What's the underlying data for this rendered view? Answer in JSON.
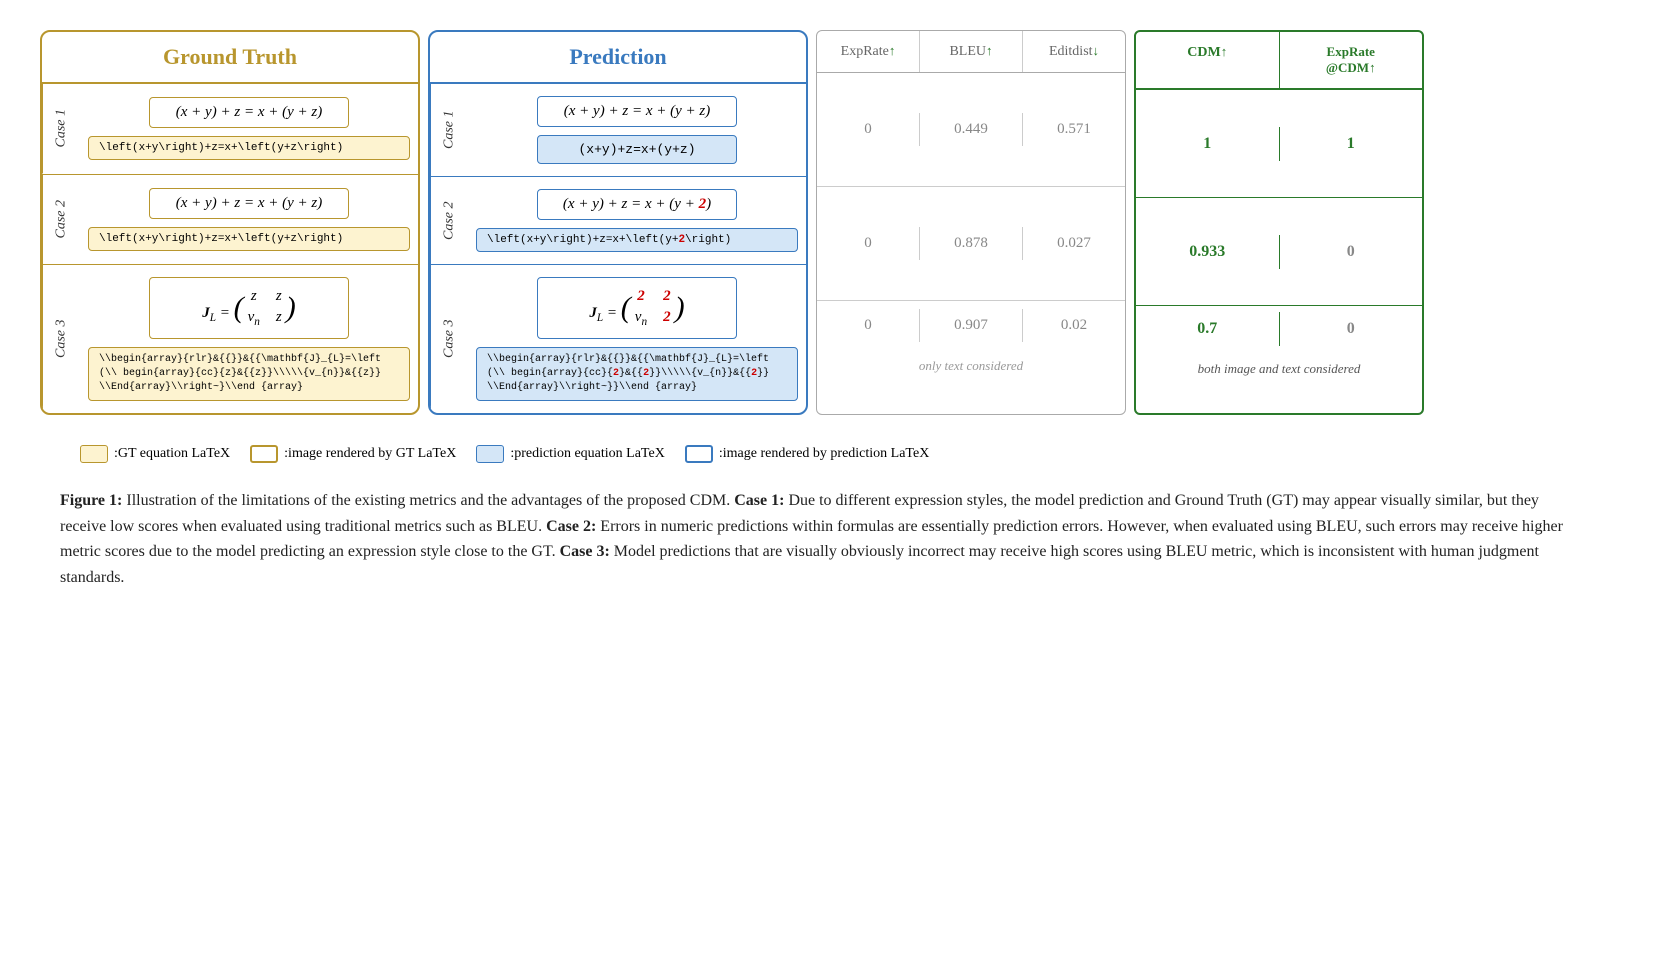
{
  "header": {
    "gt_label": "Ground Truth",
    "pred_label": "Prediction"
  },
  "metrics_headers": [
    {
      "label": "ExpRate",
      "arrow": "up"
    },
    {
      "label": "BLEU",
      "arrow": "up"
    },
    {
      "label": "Editdist",
      "arrow": "down"
    }
  ],
  "cdm_headers": [
    {
      "label": "CDM",
      "arrow": "up"
    },
    {
      "label": "ExpRate\n@CDM",
      "arrow": "up"
    }
  ],
  "cases": [
    {
      "label": "Case 1",
      "gt_formula_display": "(x+y)+z=x+(y+z)",
      "gt_latex": "\\left(x+y\\right)+z=x+\\left(y+z\\right)",
      "pred_formula_display": "(x+y)+z=x+(y+z)",
      "pred_latex": "(x+y)+z=x+(y+z)",
      "exprate": "0",
      "bleu": "0.449",
      "editdist": "0.571",
      "cdm": "1",
      "cdm_exprate": "1",
      "cdm_green": true,
      "exprate_at_cdm_green": true
    },
    {
      "label": "Case 2",
      "gt_formula_display": "(x+y)+z=x+(y+z)",
      "gt_latex": "\\left(x+y\\right)+z=x+\\left(y+z\\right)",
      "pred_formula_display": "(x+y)+z=x+(y+2)",
      "pred_latex": "\\left(x+y\\right)+z=x+\\left(y+2\\right)",
      "exprate": "0",
      "bleu": "0.878",
      "editdist": "0.027",
      "cdm": "0.933",
      "cdm_exprate": "0",
      "cdm_green": true,
      "exprate_at_cdm_green": false
    },
    {
      "label": "Case 3",
      "gt_formula_display": "matrix_jl",
      "gt_latex": "\\\\begin{array}{rlr}&{{}}&{\\\\mathbf{J}_{L}=\\\\left(\\\\begin{array}{cc}{z}&{{z}}\\\\\\\\\\\\{v_{n}}&{{z}}\\\\End{array}\\\\right~}\\\\end {array}",
      "pred_formula_display": "matrix_jl_pred",
      "pred_latex": "\\\\begin{array}{rlr}&{{}}&{\\\\mathbf{J}_{L}=\\\\left(\\\\begin{array}{cc}{2}&{{2}}\\\\\\\\\\\\{v_{n}}&{{2}}\\\\End{array}\\\\right~}}\\\\end {array}",
      "exprate": "0",
      "bleu": "0.907",
      "editdist": "0.02",
      "cdm": "0.7",
      "cdm_exprate": "0",
      "cdm_green": true,
      "exprate_at_cdm_green": false,
      "note_metrics": "only text considered",
      "note_cdm": "both image and text considered"
    }
  ],
  "legend": [
    {
      "box_type": "yellow",
      "text": ":GT equation LaTeX"
    },
    {
      "box_type": "orange",
      "text": ":image rendered by GT LaTeX"
    },
    {
      "box_type": "blue_light",
      "text": ":prediction equation LaTeX"
    },
    {
      "box_type": "blue_outline",
      "text": ":image rendered by prediction LaTeX"
    }
  ],
  "caption": {
    "figure_num": "Figure 1:",
    "intro": " Illustration of the limitations of the existing metrics and the advantages of the proposed CDM. ",
    "case1_label": "Case 1:",
    "case1_text": " Due to different expression styles, the model prediction and Ground Truth (GT) may appear visually similar, but they receive low scores when evaluated using traditional metrics such as BLEU. ",
    "case2_label": "Case 2:",
    "case2_text": " Errors in numeric predictions within formulas are essentially prediction errors. However, when evaluated using BLEU, such errors may receive higher metric scores due to the model predicting an expression style close to the GT. ",
    "case3_label": "Case 3:",
    "case3_text": " Model predictions that are visually obviously incorrect may receive high scores using BLEU metric, which is inconsistent with human judgment standards."
  }
}
